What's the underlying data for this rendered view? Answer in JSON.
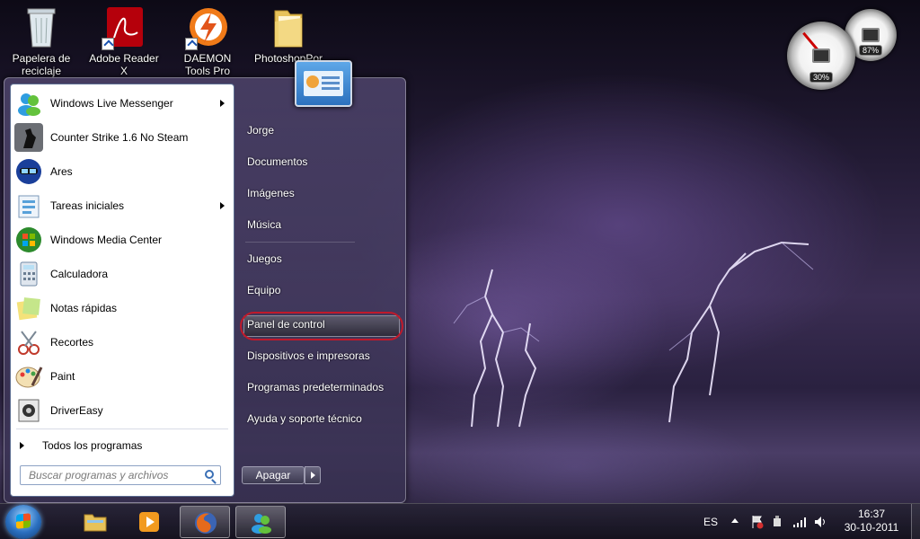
{
  "desktop": {
    "icons": [
      {
        "label": "Papelera de reciclaje"
      },
      {
        "label": "Adobe Reader X"
      },
      {
        "label": "DAEMON Tools Pro"
      },
      {
        "label": "PhotoshopPor"
      }
    ]
  },
  "gadget": {
    "cpu": "30%",
    "ram": "87%"
  },
  "start_menu": {
    "programs": [
      {
        "label": "Windows Live Messenger",
        "submenu": true
      },
      {
        "label": "Counter Strike 1.6 No Steam"
      },
      {
        "label": "Ares"
      },
      {
        "label": "Tareas iniciales",
        "submenu": true
      },
      {
        "label": "Windows Media Center"
      },
      {
        "label": "Calculadora"
      },
      {
        "label": "Notas rápidas"
      },
      {
        "label": "Recortes"
      },
      {
        "label": "Paint"
      },
      {
        "label": "DriverEasy"
      }
    ],
    "all_programs": "Todos los programas",
    "search_placeholder": "Buscar programas y archivos",
    "right": {
      "user": "Jorge",
      "documents": "Documentos",
      "pictures": "Imágenes",
      "music": "Música",
      "games": "Juegos",
      "computer": "Equipo",
      "control_panel": "Panel de control",
      "devices": "Dispositivos e impresoras",
      "default_programs": "Programas predeterminados",
      "help": "Ayuda y soporte técnico"
    },
    "shutdown": "Apagar"
  },
  "taskbar": {
    "language": "ES",
    "time": "16:37",
    "date": "30-10-2011"
  },
  "colors": {
    "highlight_circle": "#c0192a"
  }
}
